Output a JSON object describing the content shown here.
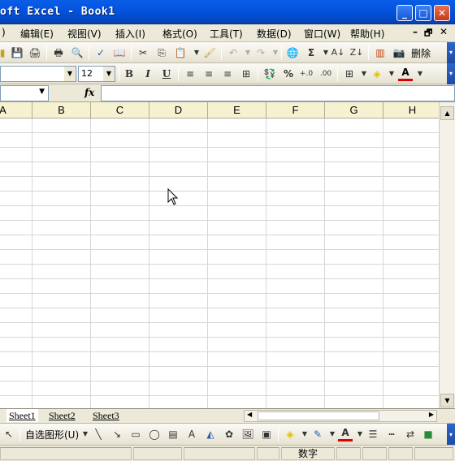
{
  "window": {
    "title": "oft Excel - Book1",
    "btn_min": "_",
    "btn_max": "□",
    "btn_close": "✕"
  },
  "menubar": {
    "items": [
      {
        "label": ")"
      },
      {
        "label": "编辑(E)"
      },
      {
        "label": "视图(V)"
      },
      {
        "label": "插入(I)"
      },
      {
        "label": "格式(O)"
      },
      {
        "label": "工具(T)"
      },
      {
        "label": "数据(D)"
      },
      {
        "label": "窗口(W)"
      },
      {
        "label": "帮助(H)"
      }
    ],
    "mdi_min": "–",
    "mdi_restore": "🗗",
    "mdi_close": "✕"
  },
  "standard_toolbar": {
    "sum": "Σ",
    "delete_label": "删除"
  },
  "format_toolbar": {
    "font_name": "",
    "font_size": "12",
    "bold": "B",
    "italic": "I",
    "underline": "U",
    "percent": "%",
    "font_color": "A"
  },
  "formula_bar": {
    "name_box": "",
    "fx": "fx",
    "formula": ""
  },
  "grid": {
    "columns": [
      "A",
      "B",
      "C",
      "D",
      "E",
      "F",
      "G",
      "H"
    ]
  },
  "sheets": {
    "tabs": [
      "Sheet1",
      "Sheet2",
      "Sheet3"
    ]
  },
  "drawing_toolbar": {
    "autoshapes_label": "自选图形(U)",
    "font_color": "A"
  },
  "statusbar": {
    "mode": "数字"
  },
  "colors": {
    "titlebar": "#0454e0",
    "header_bg": "#f6f1d0",
    "grid_line": "#d6d6d6"
  }
}
